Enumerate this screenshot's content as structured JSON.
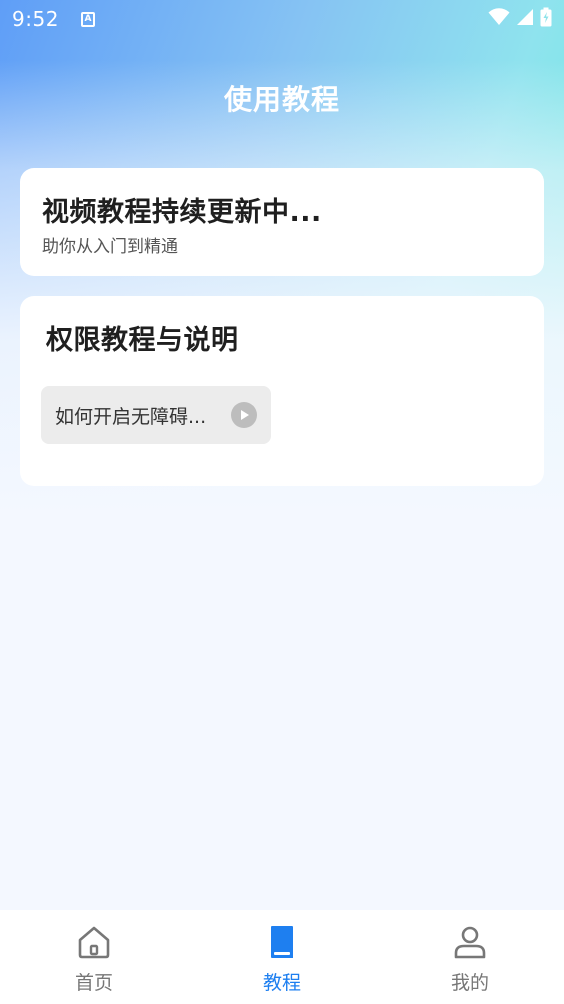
{
  "status_bar": {
    "time": "9:52",
    "notification_letter": "A"
  },
  "header": {
    "title": "使用教程"
  },
  "video_card": {
    "title": "视频教程持续更新中...",
    "subtitle": "助你从入门到精通"
  },
  "permission_card": {
    "title": "权限教程与说明",
    "items": [
      {
        "label": "如何开启无障碍..."
      }
    ]
  },
  "tabbar": {
    "tabs": [
      {
        "label": "首页",
        "icon": "home-icon",
        "active": false
      },
      {
        "label": "教程",
        "icon": "book-icon",
        "active": true
      },
      {
        "label": "我的",
        "icon": "person-icon",
        "active": false
      }
    ]
  },
  "colors": {
    "accent": "#1e7ff0",
    "inactive": "#777777",
    "card_bg": "#ffffff",
    "chip_bg": "#ececec"
  }
}
